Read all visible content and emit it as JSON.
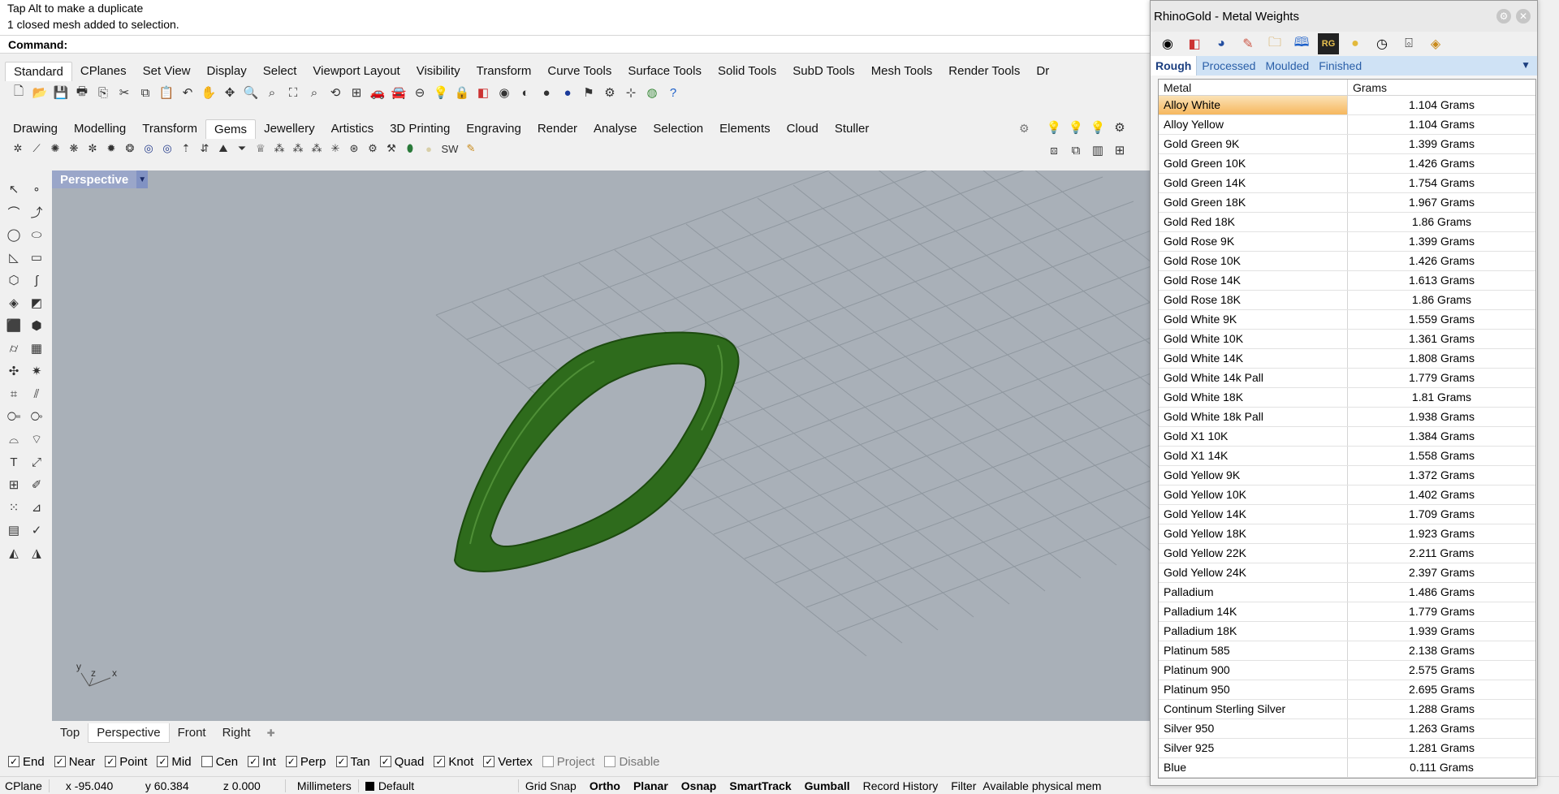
{
  "command": {
    "history": [
      "Tap Alt to make a duplicate",
      "1 closed mesh added to selection."
    ],
    "prompt": "Command:"
  },
  "toolbar_tabs_1": [
    "Standard",
    "CPlanes",
    "Set View",
    "Display",
    "Select",
    "Viewport Layout",
    "Visibility",
    "Transform",
    "Curve Tools",
    "Surface Tools",
    "Solid Tools",
    "SubD Tools",
    "Mesh Tools",
    "Render Tools",
    "Dr"
  ],
  "toolbar_tabs_2": [
    "Drawing",
    "Modelling",
    "Transform",
    "Gems",
    "Jewellery",
    "Artistics",
    "3D Printing",
    "Engraving",
    "Render",
    "Analyse",
    "Selection",
    "Elements",
    "Cloud",
    "Stuller"
  ],
  "gems_sw_label": "SW",
  "viewport": {
    "title": "Perspective",
    "axis": {
      "x": "x",
      "y": "y",
      "z": "z"
    }
  },
  "viewport_tabs": [
    "Top",
    "Perspective",
    "Front",
    "Right"
  ],
  "osnaps": [
    {
      "label": "End",
      "checked": true
    },
    {
      "label": "Near",
      "checked": true
    },
    {
      "label": "Point",
      "checked": true
    },
    {
      "label": "Mid",
      "checked": true
    },
    {
      "label": "Cen",
      "checked": false
    },
    {
      "label": "Int",
      "checked": true
    },
    {
      "label": "Perp",
      "checked": true
    },
    {
      "label": "Tan",
      "checked": true
    },
    {
      "label": "Quad",
      "checked": true
    },
    {
      "label": "Knot",
      "checked": true
    },
    {
      "label": "Vertex",
      "checked": true
    },
    {
      "label": "Project",
      "checked": false,
      "disabled": true
    },
    {
      "label": "Disable",
      "checked": false,
      "disabled": true
    }
  ],
  "status": {
    "cplane": "CPlane",
    "x": "x -95.040",
    "y": "y 60.384",
    "z": "z 0.000",
    "units": "Millimeters",
    "layer": "Default",
    "grid_snap": "Grid Snap",
    "ortho": "Ortho",
    "planar": "Planar",
    "osnap": "Osnap",
    "smarttrack": "SmartTrack",
    "gumball": "Gumball",
    "record_history": "Record History",
    "filter": "Filter",
    "memory": "Available physical mem"
  },
  "panel": {
    "title": "RhinoGold - Metal Weights",
    "tabs": [
      "Rough",
      "Processed",
      "Moulded",
      "Finished"
    ],
    "columns": [
      "Metal",
      "Grams"
    ],
    "rows": [
      [
        "Alloy White",
        "1.104 Grams"
      ],
      [
        "Alloy Yellow",
        "1.104 Grams"
      ],
      [
        "Gold Green 9K",
        "1.399 Grams"
      ],
      [
        "Gold Green 10K",
        "1.426 Grams"
      ],
      [
        "Gold Green 14K",
        "1.754 Grams"
      ],
      [
        "Gold Green 18K",
        "1.967 Grams"
      ],
      [
        "Gold Red 18K",
        "1.86 Grams"
      ],
      [
        "Gold Rose 9K",
        "1.399 Grams"
      ],
      [
        "Gold Rose 10K",
        "1.426 Grams"
      ],
      [
        "Gold Rose 14K",
        "1.613 Grams"
      ],
      [
        "Gold Rose 18K",
        "1.86 Grams"
      ],
      [
        "Gold White 9K",
        "1.559 Grams"
      ],
      [
        "Gold White 10K",
        "1.361 Grams"
      ],
      [
        "Gold White 14K",
        "1.808 Grams"
      ],
      [
        "Gold White 14k Pall",
        "1.779 Grams"
      ],
      [
        "Gold White 18K",
        "1.81 Grams"
      ],
      [
        "Gold White 18k Pall",
        "1.938 Grams"
      ],
      [
        "Gold X1 10K",
        "1.384 Grams"
      ],
      [
        "Gold X1 14K",
        "1.558 Grams"
      ],
      [
        "Gold Yellow 9K",
        "1.372 Grams"
      ],
      [
        "Gold Yellow 10K",
        "1.402 Grams"
      ],
      [
        "Gold Yellow 14K",
        "1.709 Grams"
      ],
      [
        "Gold Yellow 18K",
        "1.923 Grams"
      ],
      [
        "Gold Yellow 22K",
        "2.211 Grams"
      ],
      [
        "Gold Yellow 24K",
        "2.397 Grams"
      ],
      [
        "Palladium",
        "1.486 Grams"
      ],
      [
        "Palladium 14K",
        "1.779 Grams"
      ],
      [
        "Palladium 18K",
        "1.939 Grams"
      ],
      [
        "Platinum 585",
        "2.138 Grams"
      ],
      [
        "Platinum 900",
        "2.575 Grams"
      ],
      [
        "Platinum 950",
        "2.695 Grams"
      ],
      [
        "Continum Sterling Silver",
        "1.288 Grams"
      ],
      [
        "Silver 950",
        "1.263 Grams"
      ],
      [
        "Silver 925",
        "1.281 Grams"
      ],
      [
        "Blue",
        "0.111 Grams"
      ]
    ]
  },
  "colors": {
    "ring": "#2e6b1c",
    "viewport": "#a9b0b8",
    "accent": "#f6b75e",
    "tab_bg": "#cfe2f5"
  }
}
